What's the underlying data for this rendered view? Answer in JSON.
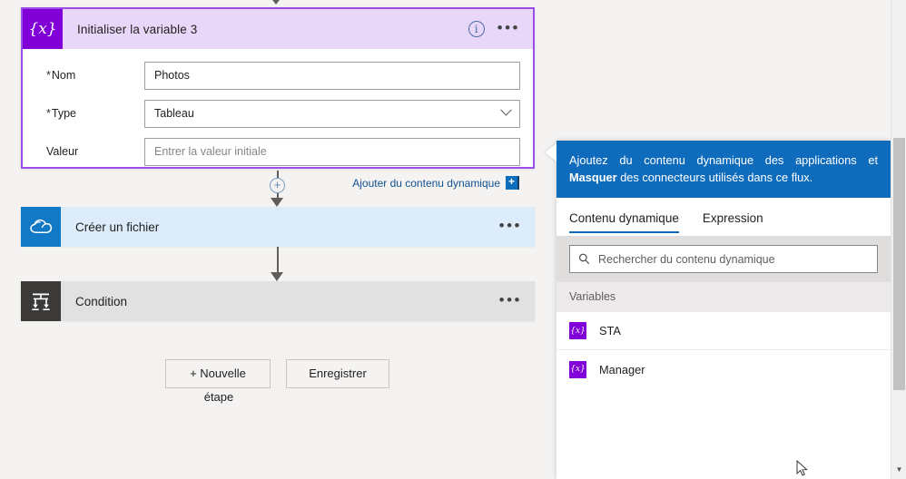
{
  "designer": {
    "variable_card": {
      "icon": "variable-braces-icon",
      "title": "Initialiser la variable 3",
      "info_icon": "info-icon",
      "menu_icon": "ellipsis-icon",
      "fields": [
        {
          "label": "Nom",
          "required": true,
          "value": "Photos",
          "placeholder": "",
          "control": "text"
        },
        {
          "label": "Type",
          "required": true,
          "value": "Tableau",
          "placeholder": "",
          "control": "dropdown"
        },
        {
          "label": "Valeur",
          "required": false,
          "value": "",
          "placeholder": "Entrer la valeur initiale",
          "control": "text"
        }
      ],
      "dynamic_link": "Ajouter du contenu dynamique",
      "dynamic_plus": "+"
    },
    "add_step_plus": "+",
    "actions": [
      {
        "name": "onedrive",
        "icon": "onedrive-cloud-icon",
        "label": "Créer un fichier",
        "menu_icon": "ellipsis-icon"
      },
      {
        "name": "condition",
        "icon": "condition-branch-icon",
        "label": "Condition",
        "menu_icon": "ellipsis-icon"
      }
    ],
    "buttons": {
      "new_step_line1": "+ Nouvelle",
      "new_step_line2": "étape",
      "save": "Enregistrer"
    }
  },
  "panel": {
    "banner": {
      "text": "Ajoutez du contenu dynamique des applications et",
      "hide_link": "Masquer",
      "text2": "des connecteurs utilisés dans ce flux."
    },
    "tabs": [
      {
        "label": "Contenu dynamique",
        "active": true
      },
      {
        "label": "Expression",
        "active": false
      }
    ],
    "search": {
      "icon": "search-icon",
      "placeholder": "Rechercher du contenu dynamique",
      "value": ""
    },
    "group_title": "Variables",
    "items": [
      {
        "icon": "variable-braces-icon",
        "label": "STA"
      },
      {
        "icon": "variable-braces-icon",
        "label": "Manager"
      }
    ]
  },
  "scrollbar": {
    "down_arrow": "▼"
  },
  "colors": {
    "variable_purple": "#8000d7",
    "variable_header_lilac": "#e9d7f9",
    "panel_blue": "#0f6cbd",
    "onedrive_blue": "#1279c6",
    "condition_gray": "#3b3a39",
    "canvas_bg": "#f4f3f2",
    "link_blue": "#12518f"
  }
}
